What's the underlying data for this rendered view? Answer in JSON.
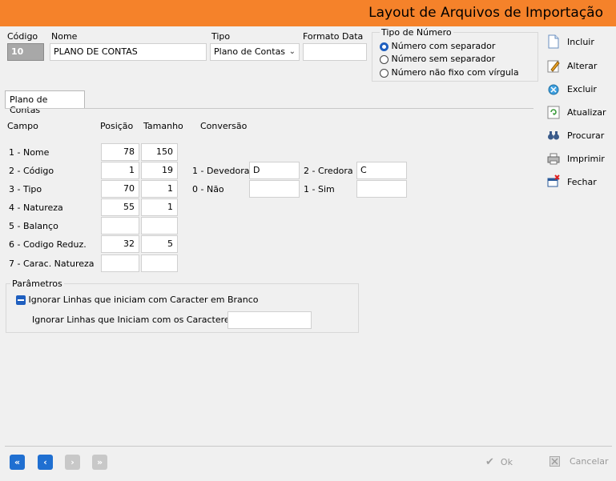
{
  "header": {
    "title": "Layout de Arquivos de Importação",
    "accent_color": "#f5822a"
  },
  "form": {
    "codigo_label": "Código",
    "codigo_value": "10",
    "nome_label": "Nome",
    "nome_value": "PLANO DE CONTAS",
    "tipo_label": "Tipo",
    "tipo_value": "Plano de Contas",
    "formato_data_label": "Formato Data",
    "formato_data_value": ""
  },
  "tipo_numero": {
    "legend": "Tipo de Número",
    "options": [
      {
        "label": "Número com separador",
        "selected": true
      },
      {
        "label": "Número sem separador",
        "selected": false
      },
      {
        "label": "Número não fixo com vírgula",
        "selected": false
      }
    ]
  },
  "tab": {
    "label": "Plano de Contas"
  },
  "columns": {
    "campo": "Campo",
    "posicao": "Posição",
    "tamanho": "Tamanho",
    "conversao": "Conversão"
  },
  "rows": [
    {
      "campo": "1 - Nome",
      "posicao": "78",
      "tamanho": "150"
    },
    {
      "campo": "2 - Código",
      "posicao": "1",
      "tamanho": "19"
    },
    {
      "campo": "3 - Tipo",
      "posicao": "70",
      "tamanho": "1"
    },
    {
      "campo": "4 - Natureza",
      "posicao": "55",
      "tamanho": "1"
    },
    {
      "campo": "5 - Balanço",
      "posicao": "",
      "tamanho": ""
    },
    {
      "campo": "6 - Codigo Reduz.",
      "posicao": "32",
      "tamanho": "5"
    },
    {
      "campo": "7 - Carac. Natureza",
      "posicao": "",
      "tamanho": ""
    }
  ],
  "conversao": {
    "devedora_label": "1 - Devedora",
    "devedora_value": "D",
    "credora_label": "2 - Credora",
    "credora_value": "C",
    "nao_label": "0 - Não",
    "nao_value": "",
    "sim_label": "1 - Sim",
    "sim_value": ""
  },
  "parametros": {
    "legend": "Parâmetros",
    "ignore_blank_label": "Ignorar Linhas que iniciam com Caracter em Branco",
    "ignore_chars_label": "Ignorar Linhas que Iniciam com os Caracteres:",
    "ignore_chars_value": ""
  },
  "sidebar": {
    "incluir": "Incluir",
    "alterar": "Alterar",
    "excluir": "Excluir",
    "atualizar": "Atualizar",
    "procurar": "Procurar",
    "imprimir": "Imprimir",
    "fechar": "Fechar"
  },
  "footer": {
    "ok_label": "Ok",
    "cancelar_label": "Cancelar",
    "nav_first": "«",
    "nav_prev": "‹",
    "nav_next": "›",
    "nav_last": "»"
  }
}
